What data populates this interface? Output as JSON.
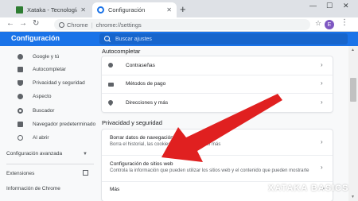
{
  "browser": {
    "tabs": [
      {
        "title": "Xataka - Tecnología y gadgets, m",
        "active": false,
        "favicon": "xataka-favicon"
      },
      {
        "title": "Configuración",
        "active": true,
        "favicon": "settings-gear-favicon"
      }
    ],
    "new_tab_label": "+",
    "window_controls": [
      "—",
      "☐",
      "✕"
    ],
    "address": {
      "badge": "Chrome",
      "separator": "|",
      "url": "chrome://settings"
    },
    "avatar_letter": "E"
  },
  "settings": {
    "title": "Configuración",
    "search_placeholder": "Buscar ajustes",
    "sidebar": {
      "items": [
        {
          "label": "Google y tú",
          "icon": "person-icon"
        },
        {
          "label": "Autocompletar",
          "icon": "clipboard-icon"
        },
        {
          "label": "Privacidad y seguridad",
          "icon": "shield-icon"
        },
        {
          "label": "Aspecto",
          "icon": "palette-icon"
        },
        {
          "label": "Buscador",
          "icon": "search-icon"
        },
        {
          "label": "Navegador predeterminado",
          "icon": "browser-icon"
        },
        {
          "label": "Al abrir",
          "icon": "power-icon"
        }
      ],
      "advanced": "Configuración avanzada",
      "extensions": "Extensiones",
      "about": "Información de Chrome"
    },
    "autofill": {
      "heading": "Autocompletar",
      "rows": [
        {
          "label": "Contraseñas",
          "icon": "key-icon"
        },
        {
          "label": "Métodos de pago",
          "icon": "credit-card-icon"
        },
        {
          "label": "Direcciones y más",
          "icon": "location-pin-icon"
        }
      ]
    },
    "privacy": {
      "heading": "Privacidad y seguridad",
      "rows": [
        {
          "title": "Borrar datos de navegación",
          "subtitle": "Borra el historial, las cookies, la caché y mucho más"
        },
        {
          "title": "Configuración de sitios web",
          "subtitle": "Controla la información que pueden utilizar los sitios web y el contenido que pueden mostrarte"
        }
      ],
      "more": "Más"
    }
  },
  "watermark": "XATAKA BASICS",
  "colors": {
    "accent": "#1a73e8",
    "annotation_arrow": "#e02020"
  }
}
